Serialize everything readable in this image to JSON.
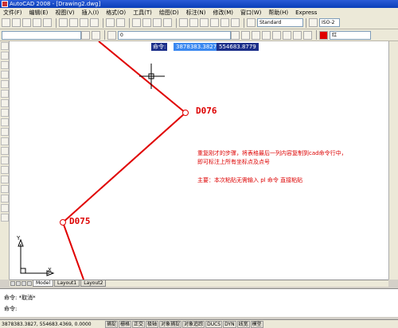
{
  "window": {
    "title": "AutoCAD 2008 - [Drawing2.dwg]"
  },
  "menu": [
    "文件(F)",
    "编辑(E)",
    "视图(V)",
    "插入(I)",
    "格式(O)",
    "工具(T)",
    "绘图(D)",
    "标注(N)",
    "修改(M)",
    "窗口(W)",
    "帮助(H)",
    "Express"
  ],
  "toolbar": {
    "text_style": "Standard",
    "dim_style": "ISO-2",
    "layer": "0",
    "color": "红"
  },
  "tooltip": {
    "label": "命令:",
    "x_value": "3878383.3827",
    "y_value": "554683.8779"
  },
  "drawing": {
    "point_labels": [
      "D076",
      "D075"
    ],
    "line_color": "#e00000"
  },
  "notes": {
    "line1": "重复刚才的步骤，将表格最后一列内容复制到cad命令行中，",
    "line2": "即可标注上所有坐标点及点号",
    "line3": "主要：本次粘贴无需输入 pl 命令 直接粘贴"
  },
  "ucs": {
    "y": "Y",
    "x": "X"
  },
  "tabs": [
    "Model",
    "Layout1",
    "Layout2"
  ],
  "command": {
    "line1": "命令: *取消*",
    "line2": "命令:"
  },
  "status": {
    "coords": "3878383.3827, 554683.4369, 0.0000",
    "buttons": [
      "捕捉",
      "栅格",
      "正交",
      "极轴",
      "对象捕捉",
      "对象追踪",
      "DUCS",
      "DYN",
      "线宽",
      "模型"
    ]
  }
}
